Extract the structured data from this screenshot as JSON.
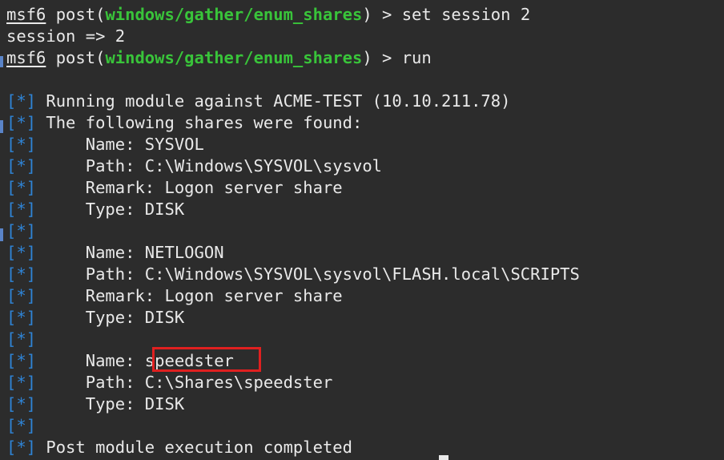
{
  "terminal": {
    "prompt": "msf6",
    "commands": [
      {
        "pre": " post(",
        "module": "windows/gather/enum_shares",
        "post": ") > set session 2"
      },
      {
        "text": "session => 2"
      },
      {
        "pre": " post(",
        "module": "windows/gather/enum_shares",
        "post": ") > run"
      }
    ],
    "output_tag": "[*]",
    "output_lines": [
      " Running module against ACME-TEST (10.10.211.78)",
      " The following shares were found:",
      "     Name: SYSVOL",
      "     Path: C:\\Windows\\SYSVOL\\sysvol",
      "     Remark: Logon server share",
      "     Type: DISK",
      "",
      "     Name: NETLOGON",
      "     Path: C:\\Windows\\SYSVOL\\sysvol\\FLASH.local\\SCRIPTS",
      "     Remark: Logon server share",
      "     Type: DISK",
      "",
      "     Name: speedster",
      "     Path: C:\\Shares\\speedster",
      "     Type: DISK",
      "",
      " Post module execution completed"
    ]
  },
  "colors": {
    "background": "#2c2c2c",
    "text": "#e9e9e9",
    "module": "#39c43a",
    "tag": "#2f84d6",
    "highlight": "#e02020"
  }
}
